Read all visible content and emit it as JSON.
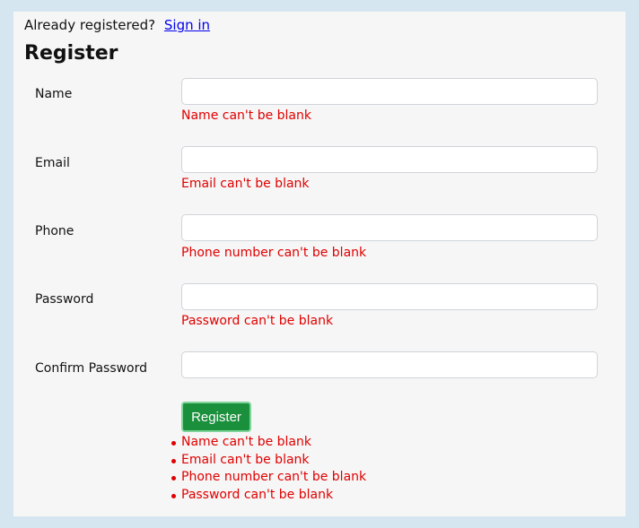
{
  "header": {
    "prompt": "Already registered?",
    "signin_link": "Sign in",
    "title": "Register"
  },
  "fields": [
    {
      "label": "Name",
      "value": "",
      "error": "Name can't be blank"
    },
    {
      "label": "Email",
      "value": "",
      "error": "Email can't be blank"
    },
    {
      "label": "Phone",
      "value": "",
      "error": "Phone number can't be blank"
    },
    {
      "label": "Password",
      "value": "",
      "error": "Password can't be blank"
    },
    {
      "label": "Confirm Password",
      "value": ""
    }
  ],
  "submit_label": "Register",
  "error_summary": [
    "Name can't be blank",
    "Email can't be blank",
    "Phone number can't be blank",
    "Password can't be blank"
  ],
  "colors": {
    "page_bg": "#d6e6f0",
    "panel_bg": "#f6f6f6",
    "error": "#e00000",
    "button_bg": "#1a8f3c",
    "link": "#0000ee"
  }
}
